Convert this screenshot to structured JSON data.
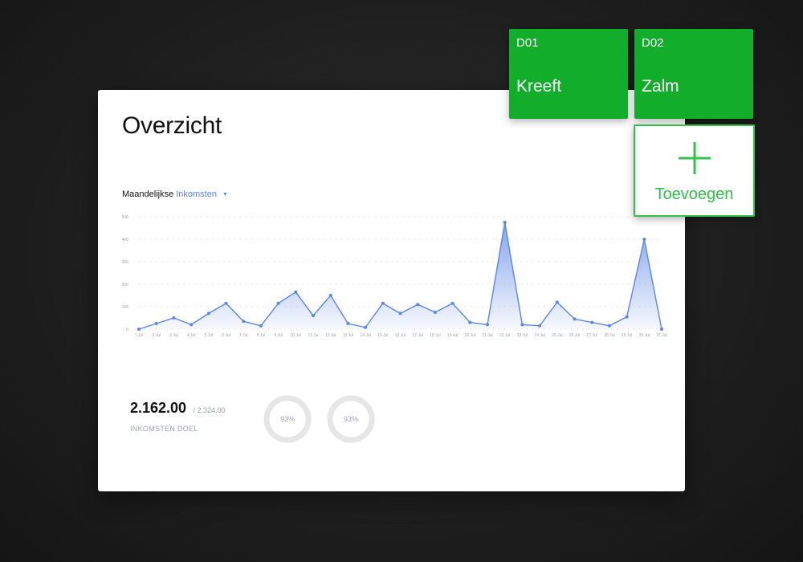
{
  "card": {
    "title": "Overzicht",
    "selector": {
      "prefix": "Maandelijkse",
      "value": "Inkomsten"
    }
  },
  "chart_data": {
    "type": "area",
    "title": "",
    "xlabel": "",
    "ylabel": "",
    "ylim": [
      0,
      500
    ],
    "y_ticks": [
      "500",
      "400",
      "300",
      "200",
      "100",
      "0"
    ],
    "grid": true,
    "color": "#5b86e5",
    "categories": [
      "1 Jul",
      "2 Jul",
      "3 Jul",
      "4 Jul",
      "5 Jul",
      "6 Jul",
      "7 Jul",
      "8 Jul",
      "9 Jul",
      "10 Jul",
      "11 Jul",
      "12 Jul",
      "13 Jul",
      "14 Jul",
      "15 Jul",
      "16 Jul",
      "17 Jul",
      "18 Jul",
      "19 Jul",
      "20 Jul",
      "21 Jul",
      "22 Jul",
      "23 Jul",
      "24 Jul",
      "25 Jul",
      "26 Jul",
      "27 Jul",
      "28 Jul",
      "29 Jul",
      "30 Jul",
      "31 Jul"
    ],
    "values": [
      0,
      25,
      50,
      20,
      70,
      115,
      35,
      15,
      115,
      165,
      60,
      150,
      25,
      8,
      115,
      70,
      110,
      75,
      115,
      30,
      20,
      475,
      20,
      15,
      120,
      45,
      30,
      15,
      55,
      400,
      0
    ]
  },
  "stats": {
    "value": "2.162.00",
    "target": "/ 2.324.00",
    "label": "INKOMSTEN DOEL"
  },
  "donuts": [
    {
      "label": "93%",
      "percent": 93
    },
    {
      "label": "93%",
      "percent": 93
    }
  ],
  "tiles": [
    {
      "code": "D01",
      "name": "Kreeft"
    },
    {
      "code": "D02",
      "name": "Zalm"
    }
  ],
  "add_tile": {
    "label": "Toevoegen"
  },
  "colors": {
    "tile_green": "#12ad2b",
    "add_green": "#2fbf4a",
    "accent_blue": "#5b86e5"
  }
}
